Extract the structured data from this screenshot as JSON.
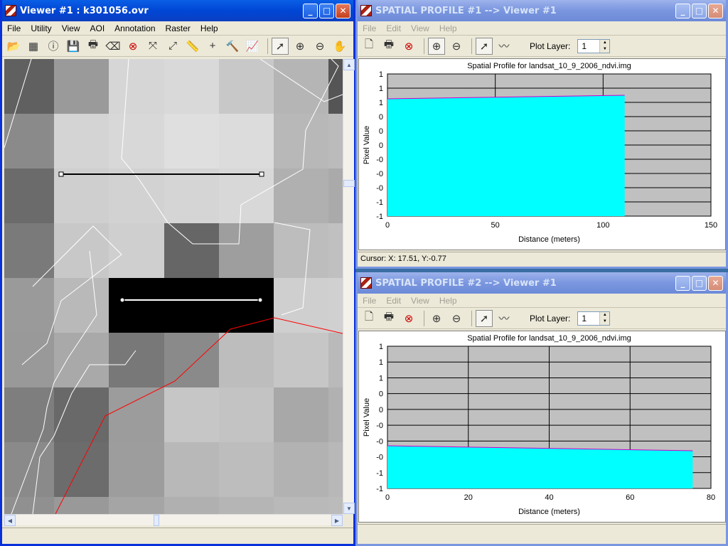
{
  "viewer": {
    "title": "Viewer #1 : k301056.ovr",
    "menus": [
      "File",
      "Utility",
      "View",
      "AOI",
      "Annotation",
      "Raster",
      "Help"
    ],
    "tools": [
      "open-icon",
      "new-layer-icon",
      "info-icon",
      "save-icon",
      "print-icon",
      "eraser-icon",
      "close-layer-icon",
      "fit-icon",
      "zoom-extent-icon",
      "measure-icon",
      "crosshair-icon",
      "hammer-icon",
      "profile-chart-icon",
      "pointer-icon",
      "zoom-in-icon",
      "zoom-out-icon",
      "pan-icon"
    ]
  },
  "profile1": {
    "title": "SPATIAL PROFILE #1 --> Viewer #1",
    "menus": [
      "File",
      "Edit",
      "View",
      "Help"
    ],
    "plot_layer_label": "Plot Layer:",
    "plot_layer_value": "1",
    "cursor_text": "Cursor: X: 17.51, Y:-0.77"
  },
  "profile2": {
    "title": "SPATIAL PROFILE #2 --> Viewer #1",
    "menus": [
      "File",
      "Edit",
      "View",
      "Help"
    ],
    "plot_layer_label": "Plot Layer:",
    "plot_layer_value": "1"
  },
  "chart_data": [
    {
      "type": "area",
      "title": "Spatial Profile for landsat_10_9_2006_ndvi.img",
      "xlabel": "Distance (meters)",
      "ylabel": "Pixel Value",
      "x_ticks": [
        "0",
        "50",
        "100",
        "150"
      ],
      "y_ticks": [
        "1",
        "1",
        "1",
        "0",
        "0",
        "0",
        "-0",
        "-0",
        "-0",
        "-1",
        "-1"
      ],
      "xlim": [
        0,
        150
      ],
      "ylim": [
        -1,
        1
      ],
      "grid": true,
      "fill_color": "#00ffff",
      "line_color": "#cc00cc",
      "x": [
        0,
        110
      ],
      "y": [
        0.65,
        0.7
      ]
    },
    {
      "type": "area",
      "title": "Spatial Profile for landsat_10_9_2006_ndvi.img",
      "xlabel": "Distance (meters)",
      "ylabel": "Pixel Value",
      "x_ticks": [
        "0",
        "20",
        "40",
        "60",
        "80"
      ],
      "y_ticks": [
        "1",
        "1",
        "1",
        "0",
        "0",
        "-0",
        "-0",
        "-0",
        "-1",
        "-1"
      ],
      "xlim": [
        0,
        80
      ],
      "ylim": [
        -1,
        1
      ],
      "grid": true,
      "fill_color": "#00ffff",
      "line_color": "#cc00cc",
      "x": [
        0,
        75.5
      ],
      "y": [
        -0.4,
        -0.47
      ]
    }
  ]
}
